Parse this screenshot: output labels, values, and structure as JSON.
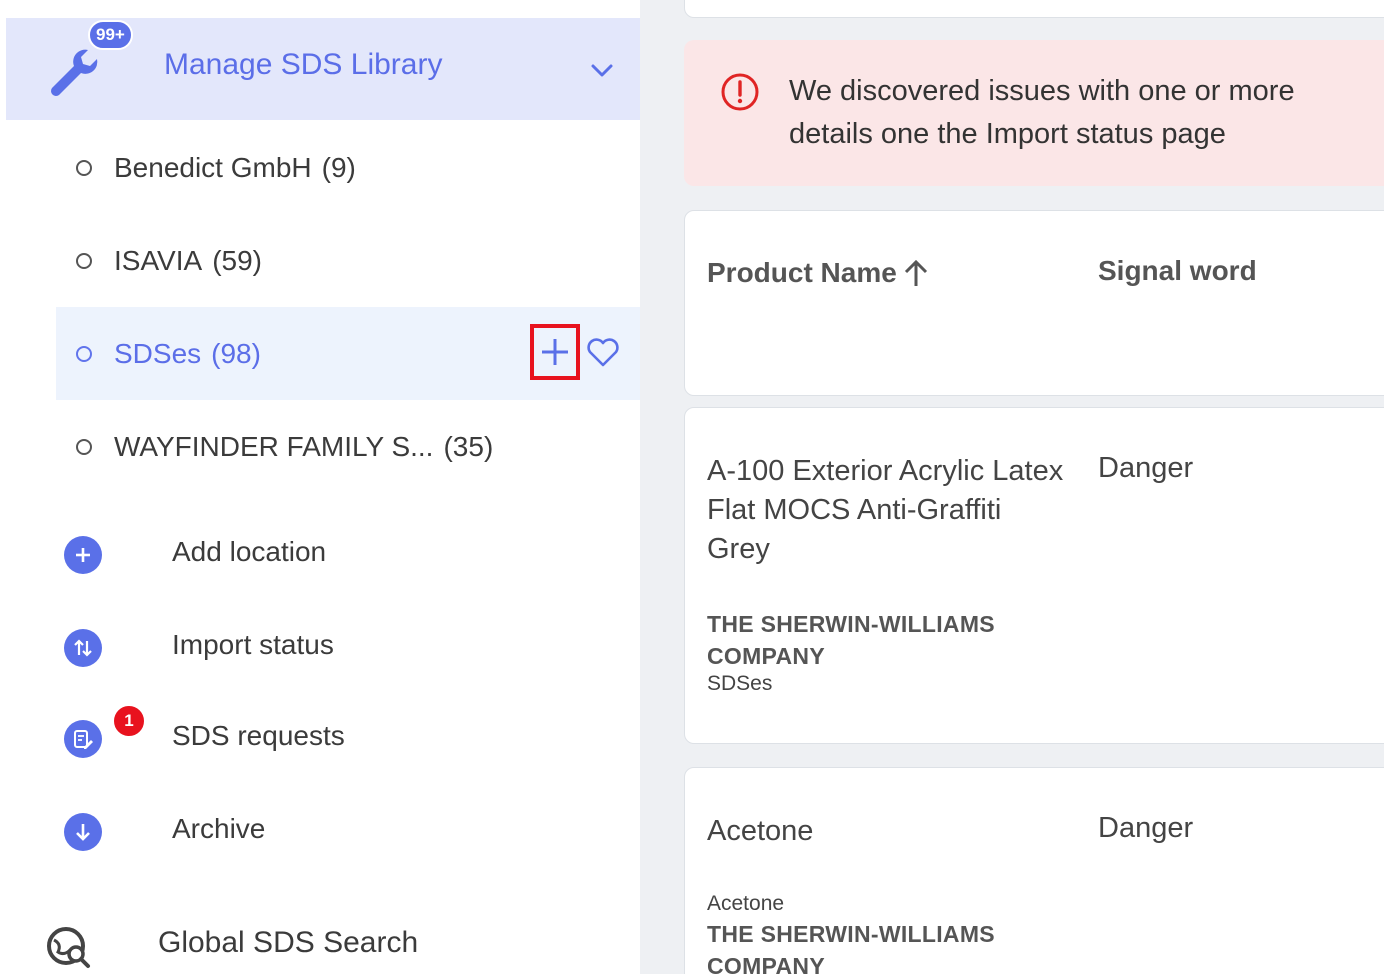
{
  "sidebar": {
    "header": {
      "label": "Manage SDS Library",
      "badge": "99+"
    },
    "locations": [
      {
        "name": "Benedict GmbH",
        "count": "(9)"
      },
      {
        "name": "ISAVIA",
        "count": "(59)"
      },
      {
        "name": "SDSes",
        "count": "(98)"
      },
      {
        "name": "WAYFINDER FAMILY S...",
        "count": "(35)"
      }
    ],
    "actions": [
      {
        "label": "Add location"
      },
      {
        "label": "Import status"
      },
      {
        "label": "SDS requests",
        "badge": "1"
      },
      {
        "label": "Archive"
      }
    ],
    "global_search": {
      "label": "Global SDS Search"
    }
  },
  "main": {
    "alert": {
      "line1": "We discovered issues with one or more",
      "line2": "details one the Import status page"
    },
    "table": {
      "headers": {
        "product": "Product Name",
        "signal": "Signal word"
      },
      "rows": [
        {
          "product_name": "A-100 Exterior Acrylic Latex Flat MOCS Anti-Graffiti Grey",
          "signal_word": "Danger",
          "manufacturer": "THE SHERWIN-WILLIAMS COMPANY",
          "location": "SDSes"
        },
        {
          "product_name": "Acetone",
          "signal_word": "Danger",
          "sub_name": "Acetone",
          "manufacturer": "THE SHERWIN-WILLIAMS COMPANY"
        }
      ]
    }
  },
  "colors": {
    "accent": "#5a70e8",
    "alert_bg": "#fbe6e7",
    "highlight": "#e8121e"
  }
}
